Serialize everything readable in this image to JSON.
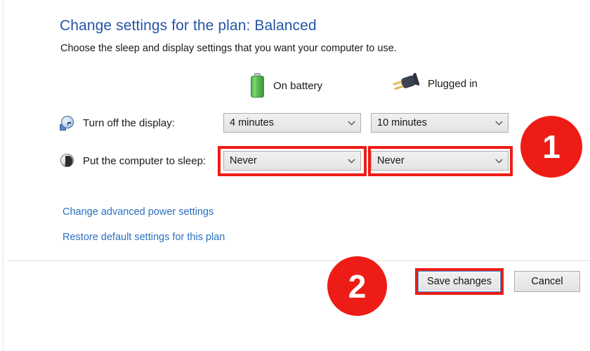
{
  "page": {
    "title": "Change settings for the plan: Balanced",
    "subtitle": "Choose the sleep and display settings that you want your computer to use."
  },
  "columns": [
    {
      "id": "battery",
      "label": "On battery",
      "icon": "battery-icon"
    },
    {
      "id": "plugged",
      "label": "Plugged in",
      "icon": "plug-icon"
    }
  ],
  "rows": [
    {
      "id": "turn-off-display",
      "label": "Turn off the display:",
      "icon": "clock-icon",
      "battery_value": "4 minutes",
      "plugged_value": "10 minutes",
      "highlighted": false
    },
    {
      "id": "put-computer-to-sleep",
      "label": "Put the computer to sleep:",
      "icon": "sleep-icon",
      "battery_value": "Never",
      "plugged_value": "Never",
      "highlighted": true
    }
  ],
  "links": [
    {
      "id": "change-advanced-power-settings",
      "label": "Change advanced power settings"
    },
    {
      "id": "restore-default-settings",
      "label": "Restore default settings for this plan"
    }
  ],
  "footer": {
    "save_label": "Save changes",
    "cancel_label": "Cancel"
  },
  "annotations": {
    "badge_1": "1",
    "badge_2": "2",
    "highlight_color": "#ee1c16",
    "badge_text_color": "#ffffff"
  },
  "colors": {
    "title_blue": "#2555a4",
    "link_blue": "#2a6fc0",
    "focus_blue": "#3f96d4",
    "battery_green": "#56bb4f"
  },
  "icons": {
    "chevron_down": "chevron-down-icon"
  }
}
